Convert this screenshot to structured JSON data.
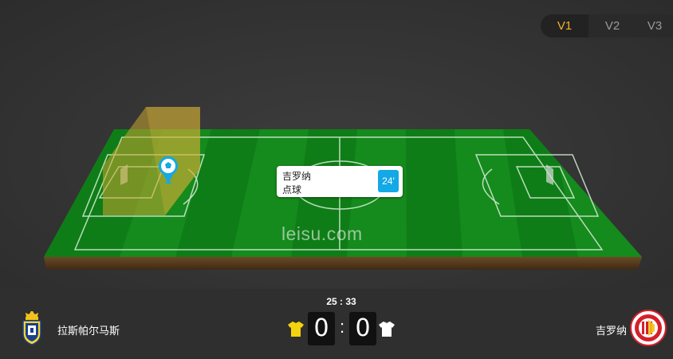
{
  "view_tabs": [
    "V1",
    "V2",
    "V3"
  ],
  "active_view": "V1",
  "event": {
    "team": "吉罗纳",
    "type": "点球",
    "minute": "24'"
  },
  "watermark": "leisu.com",
  "match": {
    "time": "25 : 33",
    "home_team": "拉斯帕尔马斯",
    "away_team": "吉罗纳",
    "home_score": "0",
    "score_separator": ":",
    "away_score": "0"
  },
  "colors": {
    "accent": "#f5b323",
    "pitch_dark": "#0f7d17",
    "pitch_light": "#1c9a24",
    "highlight_zone": "#c9a530",
    "event_badge": "#12a9e6",
    "home_shirt": "#f5d20f",
    "away_shirt": "#ffffff"
  },
  "icons": {
    "event_marker": "soccer-ball-pin-icon",
    "home_kit": "yellow-shirt-icon",
    "away_kit": "white-shirt-icon"
  }
}
